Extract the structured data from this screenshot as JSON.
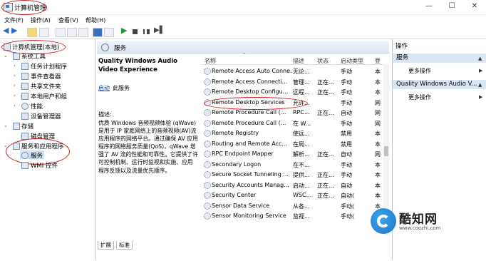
{
  "window": {
    "title": "计算机管理",
    "minimize": "—",
    "maximize": "☐",
    "close": "✕"
  },
  "menu": [
    "文件(F)",
    "操作(A)",
    "查看(V)",
    "帮助(H)"
  ],
  "tree": {
    "root": "计算机管理(本地)",
    "items": [
      {
        "label": "系统工具",
        "level": 1
      },
      {
        "label": "任务计划程序",
        "level": 2
      },
      {
        "label": "事件查看器",
        "level": 2
      },
      {
        "label": "共享文件夹",
        "level": 2
      },
      {
        "label": "本地用户和组",
        "level": 2
      },
      {
        "label": "性能",
        "level": 2
      },
      {
        "label": "设备管理器",
        "level": 2
      },
      {
        "label": "存储",
        "level": 1
      },
      {
        "label": "磁盘管理",
        "level": 2
      },
      {
        "label": "服务和应用程序",
        "level": 1
      },
      {
        "label": "服务",
        "level": 2
      },
      {
        "label": "WMI 控件",
        "level": 2
      }
    ]
  },
  "panel": {
    "header": "服务",
    "service_title": "Quality Windows Audio Video Experience",
    "start_link": "启动",
    "start_suffix": "此服务",
    "desc_label": "描述:",
    "desc_text": "优质 Windows 音频视频体验 (qWave)是用于 IP 家庭网络上的音频视频(AV)流应用程序的网络平台。通过确保 AV 应用程序的网络服务质量(QoS)，qWave 增强了 AV 流的性能和可靠性。它提供了许可控制机制、运行时监视和实施、应用程序反馈以及流量优先顺序。"
  },
  "columns": {
    "name": "名称",
    "desc": "描述",
    "status": "状态",
    "startup": "启动类型",
    "logon": "登"
  },
  "services": [
    {
      "name": "Remote Access Auto Conne...",
      "desc": "无论...",
      "status": "",
      "startup": "手动",
      "logon": "本"
    },
    {
      "name": "Remote Access Connecti...",
      "desc": "管理...",
      "status": "正在...",
      "startup": "手动",
      "logon": "本"
    },
    {
      "name": "Remote Desktop Configu...",
      "desc": "远程...",
      "status": "正在...",
      "startup": "手动",
      "logon": "本"
    },
    {
      "name": "Remote Desktop Services",
      "desc": "允许...",
      "status": "",
      "startup": "手动",
      "logon": "网"
    },
    {
      "name": "Remote Procedure Call (...",
      "desc": "RPC...",
      "status": "正在...",
      "startup": "自动",
      "logon": "网"
    },
    {
      "name": "Remote Procedure Call (...",
      "desc": "在 W...",
      "status": "",
      "startup": "手动",
      "logon": "网"
    },
    {
      "name": "Remote Registry",
      "desc": "使远...",
      "status": "",
      "startup": "禁用",
      "logon": "本"
    },
    {
      "name": "Routing and Remote Acc...",
      "desc": "在局...",
      "status": "",
      "startup": "禁用",
      "logon": "本"
    },
    {
      "name": "RPC Endpoint Mapper",
      "desc": "解析...",
      "status": "正在...",
      "startup": "自动",
      "logon": "网"
    },
    {
      "name": "Secondary Logon",
      "desc": "在不...",
      "status": "",
      "startup": "手动",
      "logon": "本"
    },
    {
      "name": "Secure Socket Tunneling ...",
      "desc": "提供...",
      "status": "正在...",
      "startup": "手动",
      "logon": "本"
    },
    {
      "name": "Security Accounts Manag...",
      "desc": "启动...",
      "status": "正在...",
      "startup": "自动",
      "logon": "本"
    },
    {
      "name": "Security Center",
      "desc": "WSC...",
      "status": "正在...",
      "startup": "自动(",
      "logon": "本"
    },
    {
      "name": "Sensor Data Service",
      "desc": "从各...",
      "status": "",
      "startup": "手动(",
      "logon": "本"
    },
    {
      "name": "Sensor Monitoring Service",
      "desc": "监视...",
      "status": "",
      "startup": "手动(",
      "logon": "本"
    }
  ],
  "tabs": [
    "扩展",
    "标准"
  ],
  "actions": {
    "header": "操作",
    "group1": "服务",
    "more1": "更多操作",
    "group2": "Quality Windows Audio V...",
    "more2": "更多操作"
  },
  "watermark": {
    "name": "酷知网",
    "url": "www.coozhi.com"
  },
  "colors": {
    "accent": "#1a73c8",
    "annotation": "#d42020",
    "link": "#0a46b4"
  }
}
